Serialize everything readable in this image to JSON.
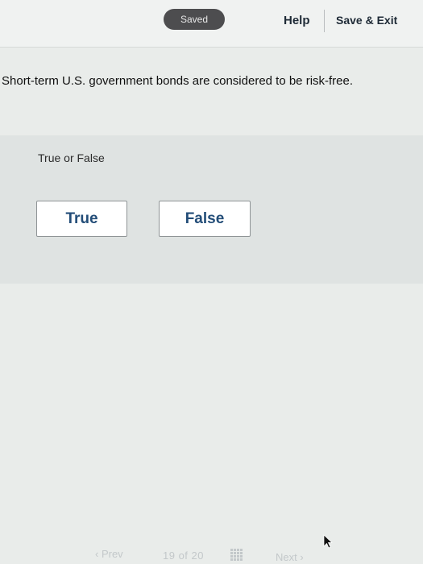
{
  "header": {
    "saved_label": "Saved",
    "help_label": "Help",
    "save_exit_label": "Save & Exit"
  },
  "question": {
    "text": "Short-term U.S. government bonds are considered to be risk-free.",
    "prompt": "True or False",
    "choices": [
      "True",
      "False"
    ]
  },
  "navigation": {
    "prev_label": "Prev",
    "page_indicator": "19 of 20",
    "next_label": "Next",
    "prev_icon": "chevron-left-icon",
    "next_icon": "chevron-right-icon",
    "grid_icon": "question-grid-icon"
  },
  "colors": {
    "accent": "#234d78",
    "saved_bg": "#4d4d4f",
    "nav_text": "#c3c8ca"
  }
}
